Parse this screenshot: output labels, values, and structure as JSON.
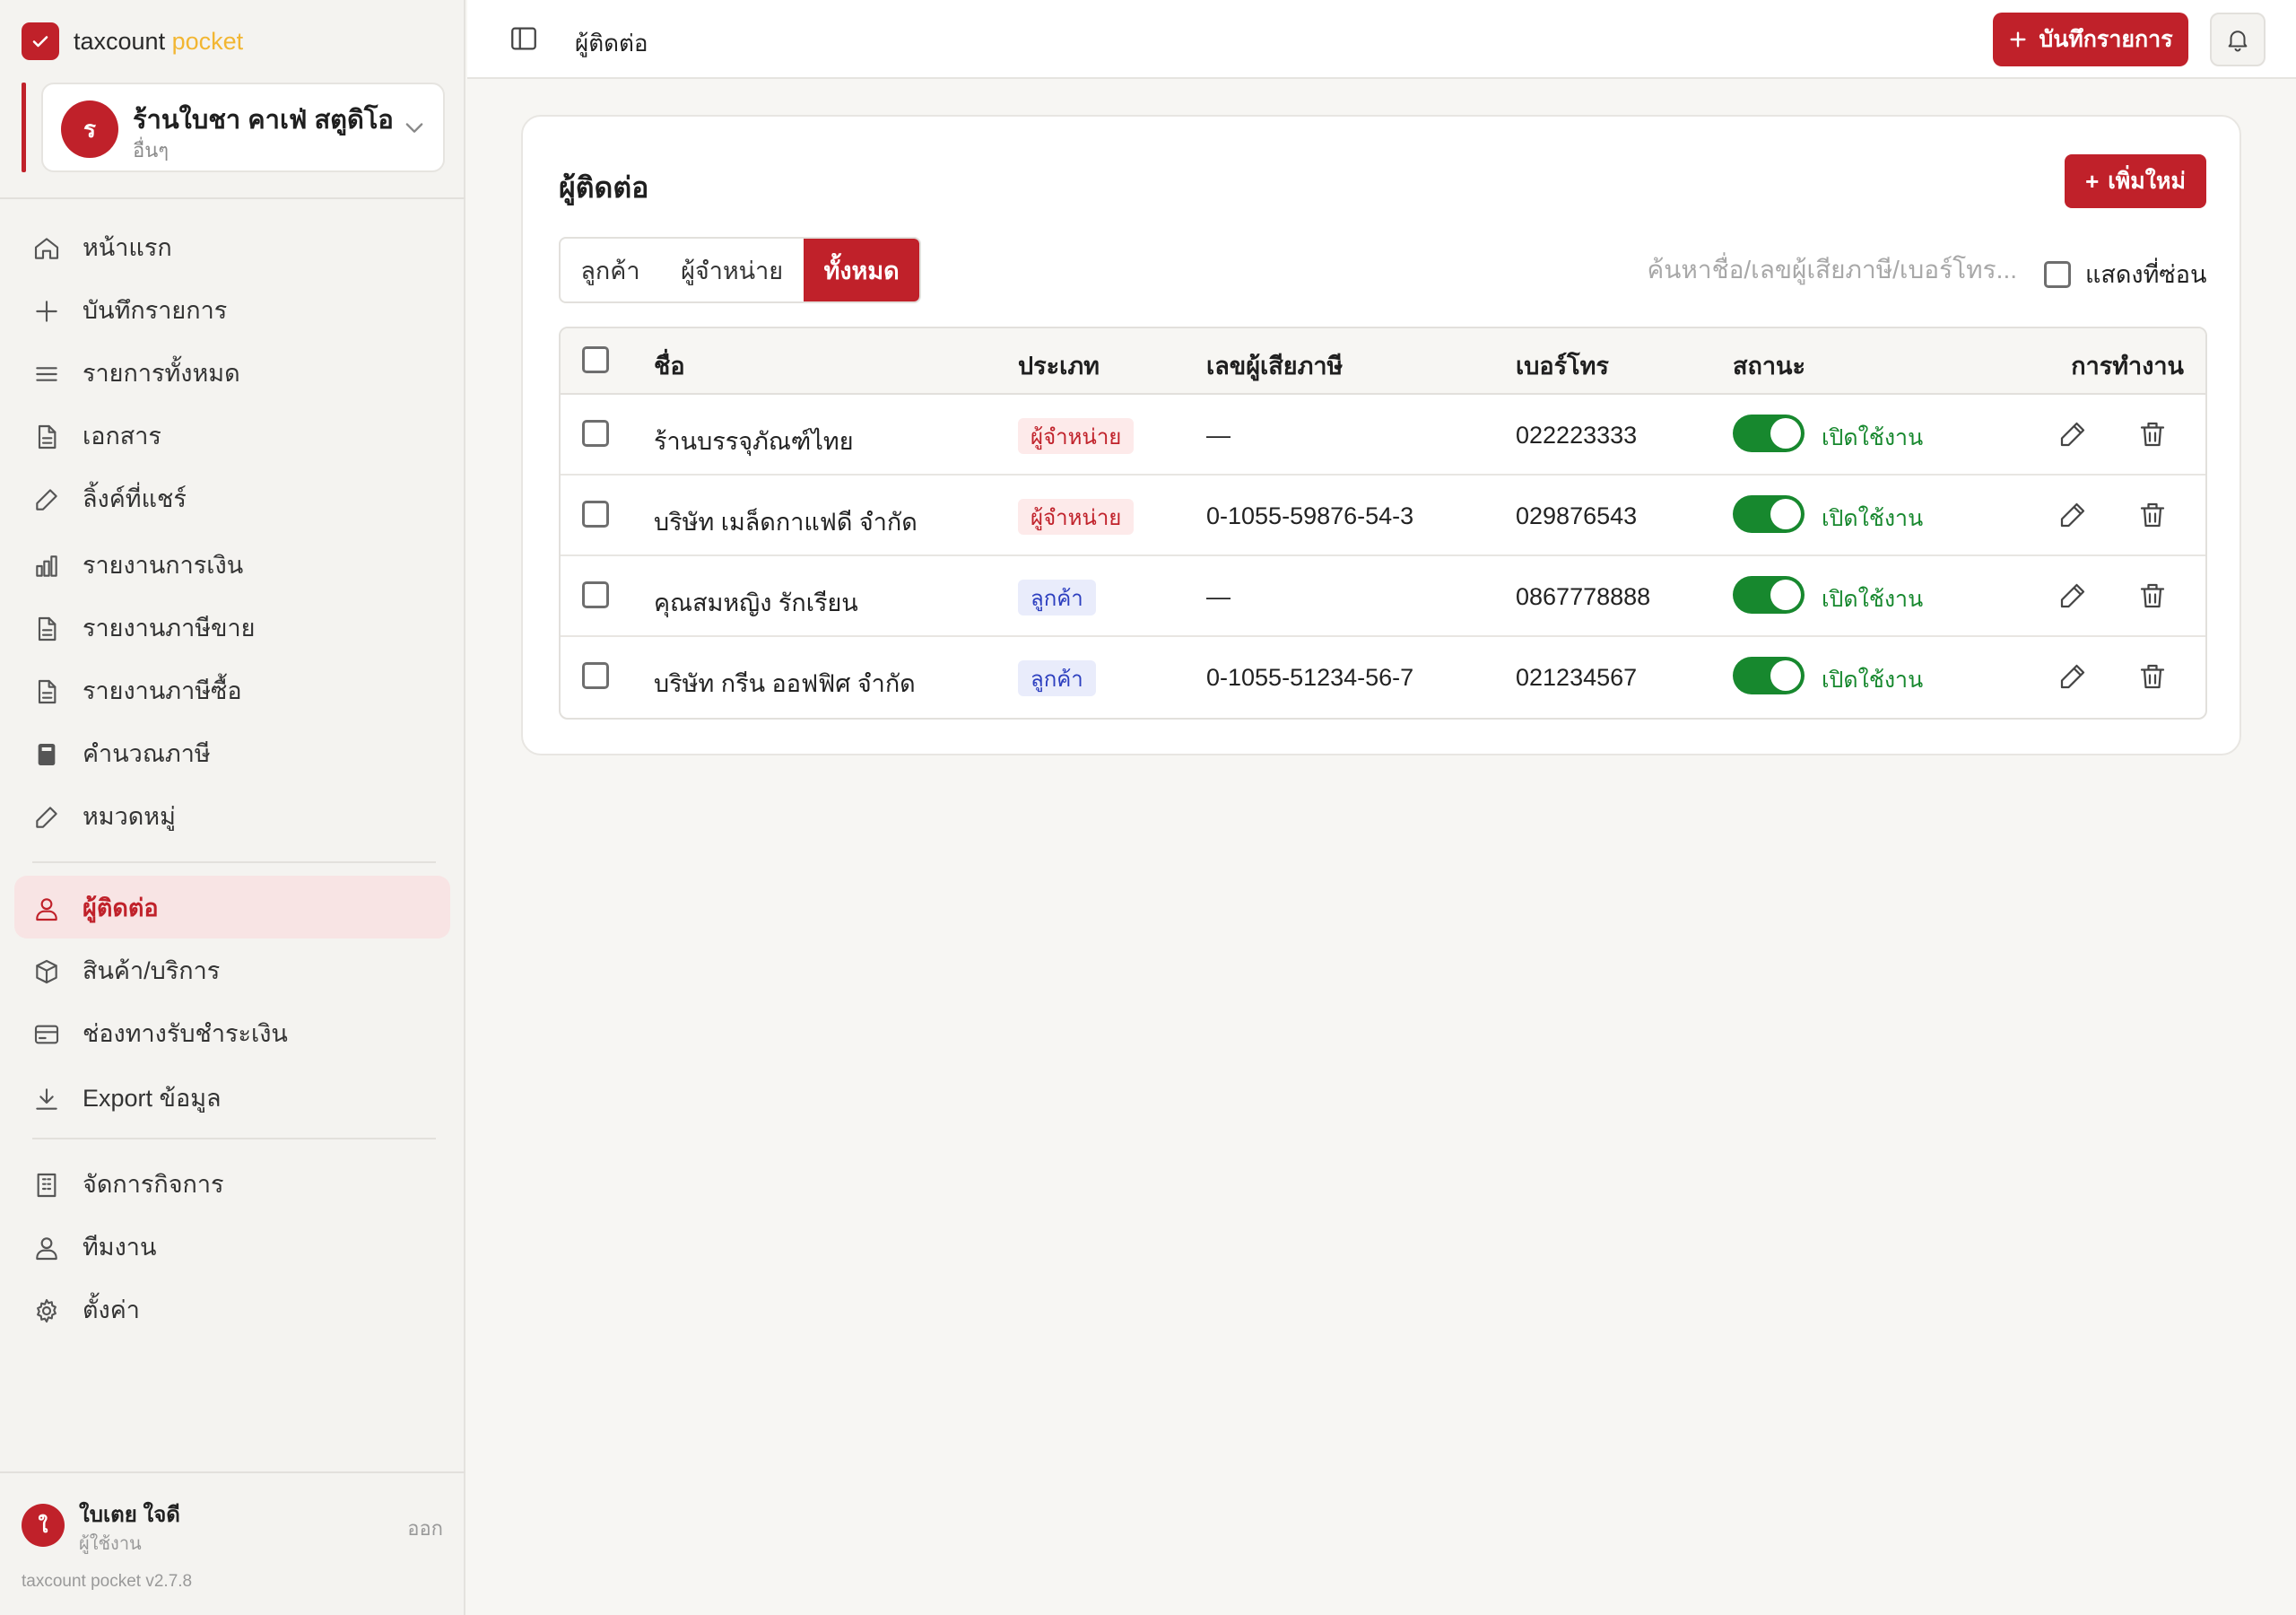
{
  "brand": {
    "name": "taxcount",
    "accent": "pocket"
  },
  "workspace": {
    "initial": "ร",
    "name": "ร้านใบชา คาเฟ่ สตูดิโอ",
    "type": "อื่นๆ"
  },
  "nav": [
    {
      "label": "หน้าแรก",
      "icon": "home-icon"
    },
    {
      "label": "บันทึกรายการ",
      "icon": "plus-icon"
    },
    {
      "label": "รายการทั้งหมด",
      "icon": "list-icon"
    },
    {
      "label": "เอกสาร",
      "icon": "document-icon"
    },
    {
      "label": "ลิ้งค์ที่แชร์",
      "icon": "pencil-icon"
    },
    {
      "label": "รายงานการเงิน",
      "icon": "bar-chart-icon"
    },
    {
      "label": "รายงานภาษีขาย",
      "icon": "document-icon"
    },
    {
      "label": "รายงานภาษีซื้อ",
      "icon": "document-icon"
    },
    {
      "label": "คำนวณภาษี",
      "icon": "calculator-icon"
    },
    {
      "label": "หมวดหมู่",
      "icon": "pencil-icon"
    },
    {
      "label": "ผู้ติดต่อ",
      "icon": "user-icon",
      "active": true
    },
    {
      "label": "สินค้า/บริการ",
      "icon": "box-icon"
    },
    {
      "label": "ช่องทางรับชำระเงิน",
      "icon": "credit-card-icon"
    },
    {
      "label": "Export ข้อมูล",
      "icon": "download-icon"
    },
    {
      "label": "จัดการกิจการ",
      "icon": "building-icon"
    },
    {
      "label": "ทีมงาน",
      "icon": "user-icon"
    },
    {
      "label": "ตั้งค่า",
      "icon": "gear-icon"
    }
  ],
  "user": {
    "initial": "ใ",
    "name": "ใบเตย ใจดี",
    "role": "ผู้ใช้งาน",
    "logout": "ออก"
  },
  "version": "taxcount pocket v2.7.8",
  "topbar": {
    "breadcrumb": "ผู้ติดต่อ",
    "record_button": "บันทึกรายการ"
  },
  "page": {
    "title": "ผู้ติดต่อ",
    "add_button": "เพิ่มใหม่",
    "tabs": [
      "ลูกค้า",
      "ผู้จำหน่าย",
      "ทั้งหมด"
    ],
    "active_tab": "ทั้งหมด",
    "search_placeholder": "ค้นหาชื่อ/เลขผู้เสียภาษี/เบอร์โทร...",
    "show_hidden_label": "แสดงที่ซ่อน",
    "show_hidden_checked": false
  },
  "table": {
    "headers": [
      "ชื่อ",
      "ประเภท",
      "เลขผู้เสียภาษี",
      "เบอร์โทร",
      "สถานะ",
      "การทำงาน"
    ],
    "rows": [
      {
        "name": "ร้านบรรจุภัณฑ์ไทย",
        "type": "ผู้จำหน่าย",
        "type_kind": "vendor",
        "tax_id": "—",
        "phone": "022223333",
        "status": "เปิดใช้งาน",
        "enabled": true
      },
      {
        "name": "บริษัท เมล็ดกาแฟดี จำกัด",
        "type": "ผู้จำหน่าย",
        "type_kind": "vendor",
        "tax_id": "0-1055-59876-54-3",
        "phone": "029876543",
        "status": "เปิดใช้งาน",
        "enabled": true
      },
      {
        "name": "คุณสมหญิง รักเรียน",
        "type": "ลูกค้า",
        "type_kind": "customer",
        "tax_id": "—",
        "phone": "0867778888",
        "status": "เปิดใช้งาน",
        "enabled": true
      },
      {
        "name": "บริษัท กรีน ออฟฟิศ จำกัด",
        "type": "ลูกค้า",
        "type_kind": "customer",
        "tax_id": "0-1055-51234-56-7",
        "phone": "021234567",
        "status": "เปิดใช้งาน",
        "enabled": true
      }
    ]
  },
  "colors": {
    "primary": "#c0212a",
    "accent_yellow": "#f2b632",
    "success": "#17882e",
    "customer_badge": "#2d3fbf"
  }
}
